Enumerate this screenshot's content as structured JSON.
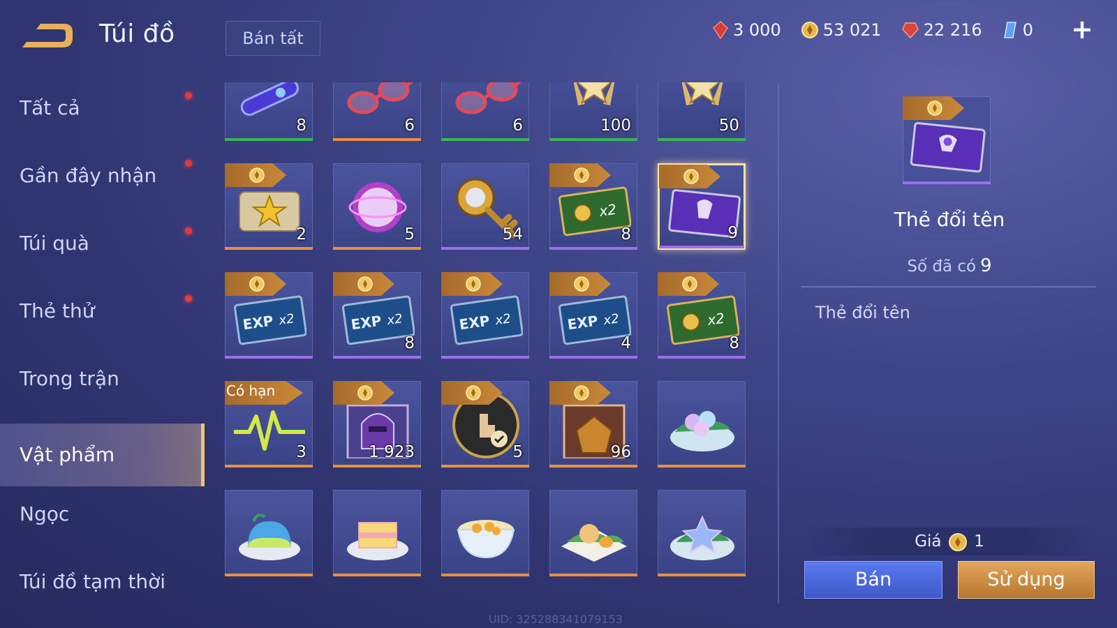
{
  "header": {
    "title": "Túi đồ",
    "sell_all_label": "Bán tất"
  },
  "currencies": [
    {
      "icon": "ruby-icon",
      "value": "3 000",
      "color": "#e44b4b"
    },
    {
      "icon": "gold-coin-icon",
      "value": "53 021",
      "color": "#e8b84a"
    },
    {
      "icon": "red-gem-icon",
      "value": "22 216",
      "color": "#e0473f"
    },
    {
      "icon": "blue-crystal-icon",
      "value": "0",
      "color": "#7fb8ff"
    }
  ],
  "sidebar": {
    "items": [
      {
        "label": "Tất cả",
        "dot": true
      },
      {
        "label": "Gần đây nhận",
        "dot": true
      },
      {
        "label": "Túi quà",
        "dot": true
      },
      {
        "label": "Thẻ thử",
        "dot": true
      },
      {
        "label": "Trong trận",
        "dot": false
      },
      {
        "label": "Vật phẩm",
        "dot": false,
        "active": true
      },
      {
        "label": "Ngọc",
        "dot": false
      },
      {
        "label": "Túi đồ tạm thời",
        "dot": false
      }
    ]
  },
  "grid": {
    "rows": [
      [
        {
          "icon": "blue-device-icon",
          "count": "8",
          "rarity": "green"
        },
        {
          "icon": "glasses-icon",
          "count": "6",
          "rarity": "orange"
        },
        {
          "icon": "glasses-icon",
          "count": "6",
          "rarity": "green"
        },
        {
          "icon": "star-emblem-icon",
          "count": "100",
          "rarity": "green"
        },
        {
          "icon": "star-emblem-icon",
          "count": "50",
          "rarity": "green"
        }
      ],
      [
        {
          "icon": "star-ticket-icon",
          "count": "2",
          "rarity": "orange",
          "tag": "coin"
        },
        {
          "icon": "pink-orb-icon",
          "count": "5",
          "rarity": "orange"
        },
        {
          "icon": "golden-key-icon",
          "count": "54",
          "rarity": "purple"
        },
        {
          "icon": "gold-x2-card-icon",
          "count": "8",
          "rarity": "purple",
          "tag": "coin",
          "text": "x2"
        },
        {
          "icon": "rename-card-icon",
          "count": "9",
          "rarity": "purple",
          "tag": "coin",
          "selected": true
        }
      ],
      [
        {
          "icon": "exp-x2-card-icon",
          "count": "",
          "rarity": "purple",
          "tag": "coin",
          "text": "EXP x2"
        },
        {
          "icon": "exp-x2-card-icon",
          "count": "8",
          "rarity": "purple",
          "tag": "coin",
          "text": "EXP x2"
        },
        {
          "icon": "exp-x2-card-icon",
          "count": "",
          "rarity": "purple",
          "tag": "coin",
          "text": "EXP x2"
        },
        {
          "icon": "exp-x2-card-icon",
          "count": "4",
          "rarity": "purple",
          "tag": "coin",
          "text": "EXP x2"
        },
        {
          "icon": "gold-x2-card-icon",
          "count": "8",
          "rarity": "purple",
          "tag": "coin",
          "text": "x2"
        }
      ],
      [
        {
          "icon": "pulse-icon",
          "count": "3",
          "rarity": "orange",
          "tag": "text",
          "tag_text": "Có hạn"
        },
        {
          "icon": "helmet-card-icon",
          "count": "1 923",
          "rarity": "orange",
          "tag": "coin"
        },
        {
          "icon": "touch-check-icon",
          "count": "5",
          "rarity": "orange",
          "tag": "coin"
        },
        {
          "icon": "treasure-card-icon",
          "count": "96",
          "rarity": "orange",
          "tag": "coin"
        },
        {
          "icon": "flower-dish-icon",
          "count": "",
          "rarity": "orange"
        }
      ],
      [
        {
          "icon": "jelly-dish-icon",
          "count": "",
          "rarity": "orange"
        },
        {
          "icon": "cake-dish-icon",
          "count": "",
          "rarity": "orange"
        },
        {
          "icon": "soup-bowl-icon",
          "count": "",
          "rarity": "orange"
        },
        {
          "icon": "cat-dish-icon",
          "count": "",
          "rarity": "orange"
        },
        {
          "icon": "star-dish-icon",
          "count": "",
          "rarity": "orange"
        }
      ]
    ]
  },
  "colors": {
    "green": "#3fb15a",
    "orange": "#e9913a",
    "purple": "#9b6ef0"
  },
  "detail": {
    "name": "Thẻ đổi tên",
    "owned_label": "Số đã có",
    "owned_value": "9",
    "description": "Thẻ đổi tên",
    "price_label": "Giá",
    "price_value": "1",
    "sell_label": "Bán",
    "use_label": "Sử dụng"
  },
  "footer": {
    "uid": "UID: 325288341079153"
  }
}
